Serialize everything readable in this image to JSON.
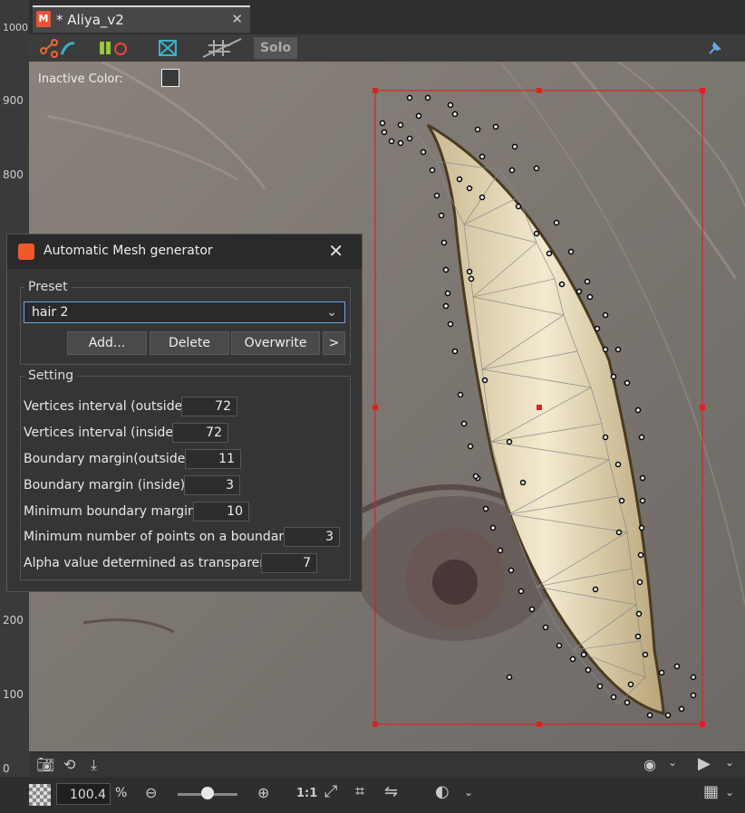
{
  "ruler": {
    "labels": [
      "1000",
      "900",
      "800",
      "200",
      "100",
      "0"
    ]
  },
  "tab": {
    "title": "* Aliya_v2",
    "close": "✕"
  },
  "toolbar": {
    "solo_label": "Solo"
  },
  "canvas": {
    "inactive_color_label": "Inactive Color:"
  },
  "dialog": {
    "title": "Automatic Mesh generator",
    "close": "✕",
    "preset_legend": "Preset",
    "preset_value": "hair 2",
    "buttons": {
      "add": "Add...",
      "delete": "Delete",
      "overwrite": "Overwrite",
      "more": ">"
    },
    "setting_legend": "Setting",
    "settings": [
      {
        "label": "Vertices interval (outside)",
        "value": "72"
      },
      {
        "label": "Vertices interval (inside)",
        "value": "72"
      },
      {
        "label": "Boundary margin(outside)",
        "value": "11"
      },
      {
        "label": "Boundary margin (inside)",
        "value": "3"
      },
      {
        "label": "Minimum boundary margin",
        "value": "10"
      },
      {
        "label": "Minimum number of points on a boundary",
        "value": "3"
      },
      {
        "label": "Alpha value determined as transparent",
        "value": "7"
      }
    ]
  },
  "bottom": {
    "zoom_value": "100.4",
    "zoom_unit": "%",
    "one_to_one": "1:1"
  },
  "colors": {
    "selection": "#e02020",
    "accent": "#6ba4e0",
    "hair": "#f0e4c2"
  }
}
